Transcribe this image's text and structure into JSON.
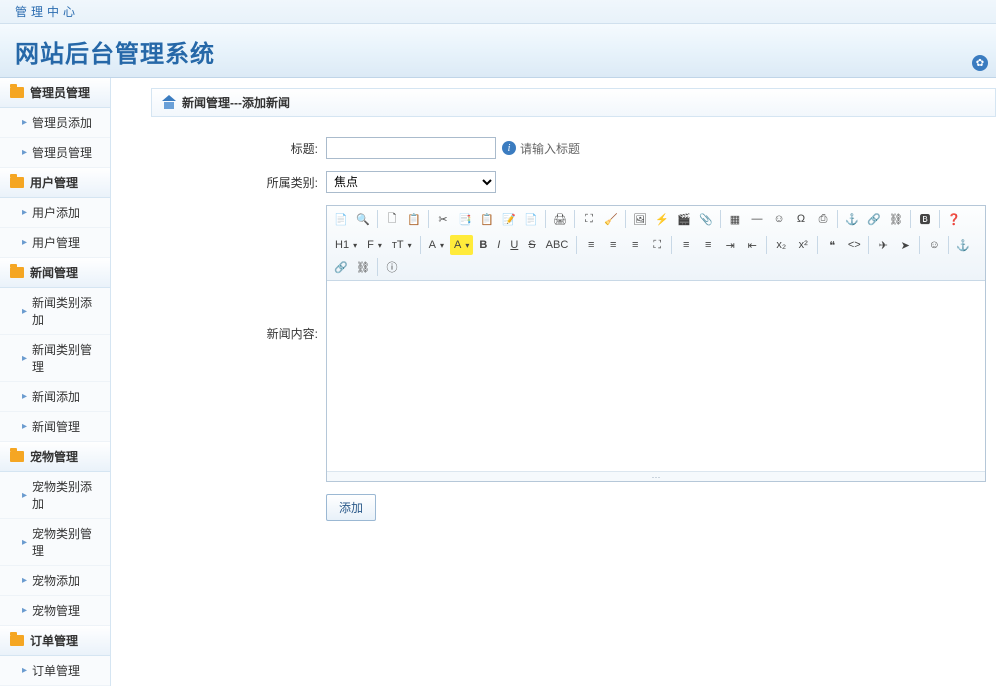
{
  "topbar": {
    "text": "管理中心"
  },
  "header": {
    "title": "网站后台管理系统"
  },
  "sidebar": {
    "groups": [
      {
        "title": "管理员管理",
        "items": [
          "管理员添加",
          "管理员管理"
        ]
      },
      {
        "title": "用户管理",
        "items": [
          "用户添加",
          "用户管理"
        ]
      },
      {
        "title": "新闻管理",
        "items": [
          "新闻类别添加",
          "新闻类别管理",
          "新闻添加",
          "新闻管理"
        ]
      },
      {
        "title": "宠物管理",
        "items": [
          "宠物类别添加",
          "宠物类别管理",
          "宠物添加",
          "宠物管理"
        ]
      },
      {
        "title": "订单管理",
        "items": [
          "订单管理"
        ]
      }
    ]
  },
  "breadcrumb": {
    "text": "新闻管理---添加新闻"
  },
  "form": {
    "title_label": "标题:",
    "title_hint": "请输入标题",
    "category_label": "所属类别:",
    "category_selected": "焦点",
    "content_label": "新闻内容:",
    "submit": "添加"
  },
  "editor": {
    "row1": [
      "source",
      "preview",
      "sep",
      "new",
      "tpl",
      "sep",
      "cut",
      "copy",
      "paste",
      "paste-text",
      "paste-word",
      "sep",
      "print",
      "sep",
      "full",
      "clear",
      "sep",
      "image",
      "flash",
      "media",
      "file",
      "sep",
      "table",
      "hr",
      "emoji",
      "char",
      "page",
      "sep",
      "anchor",
      "link",
      "unlink",
      "sep",
      "baidu",
      "sep",
      "help"
    ],
    "row2": [
      "h1",
      "font",
      "size",
      "sep",
      "fore",
      "back",
      "bold",
      "italic",
      "underline",
      "strike",
      "abc",
      "sep",
      "left",
      "center",
      "right",
      "full",
      "sep",
      "ol",
      "ul",
      "indent",
      "outdent",
      "sep",
      "sub",
      "sup",
      "sep",
      "quote",
      "code",
      "sep",
      "plane",
      "send",
      "sep",
      "smile",
      "sep",
      "anchor2",
      "link2",
      "unlink2",
      "sep",
      "about"
    ],
    "labels": {
      "h1": "H1",
      "font": "F",
      "size": "тT",
      "fore": "A",
      "back": "A",
      "bold": "B",
      "italic": "I",
      "underline": "U",
      "strike": "S",
      "abc": "ABC"
    }
  }
}
